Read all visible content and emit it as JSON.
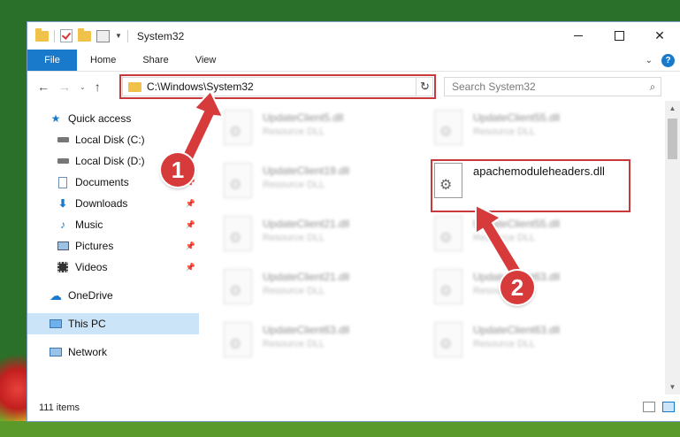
{
  "window": {
    "title": "System32"
  },
  "ribbon": {
    "tabs": [
      "File",
      "Home",
      "Share",
      "View"
    ],
    "help": "?"
  },
  "address": {
    "path": "C:\\Windows\\System32"
  },
  "search": {
    "placeholder": "Search System32"
  },
  "nav_pane": {
    "items": [
      {
        "label": "Quick access",
        "icon": "star-icon"
      },
      {
        "label": "Local Disk (C:)",
        "icon": "drive-icon"
      },
      {
        "label": "Local Disk (D:)",
        "icon": "drive-icon"
      },
      {
        "label": "Documents",
        "icon": "documents-icon",
        "pinned": true
      },
      {
        "label": "Downloads",
        "icon": "download-icon",
        "pinned": true
      },
      {
        "label": "Music",
        "icon": "music-icon",
        "pinned": true
      },
      {
        "label": "Pictures",
        "icon": "pictures-icon",
        "pinned": true
      },
      {
        "label": "Videos",
        "icon": "videos-icon",
        "pinned": true
      },
      {
        "label": "OneDrive",
        "icon": "cloud-icon"
      },
      {
        "label": "This PC",
        "icon": "computer-icon",
        "selected": true
      },
      {
        "label": "Network",
        "icon": "network-icon"
      }
    ]
  },
  "files": [
    {
      "name": "UpdateClient5.dll",
      "type": "Resource DLL"
    },
    {
      "name": "UpdateClient55.dll",
      "type": "Resource DLL"
    },
    {
      "name": "UpdateClient19.dll",
      "type": "Resource DLL"
    },
    {
      "name": "apachemoduleheaders.dll",
      "type": ""
    },
    {
      "name": "UpdateClient21.dll",
      "type": "Resource DLL"
    },
    {
      "name": "UpdateClient55.dll",
      "type": "Resource DLL"
    },
    {
      "name": "UpdateClient21.dll",
      "type": "Resource DLL"
    },
    {
      "name": "UpdateClient63.dll",
      "type": "Resource DLL"
    },
    {
      "name": "UpdateClient63.dll",
      "type": "Resource DLL"
    },
    {
      "name": "UpdateClient63.dll",
      "type": "Resource DLL"
    }
  ],
  "status": {
    "item_count": "111 items"
  },
  "annotations": {
    "step1": "1",
    "step2": "2"
  },
  "colors": {
    "accent": "#1979ca",
    "highlight": "#c9383a",
    "selected_bg": "#cce4f7"
  }
}
